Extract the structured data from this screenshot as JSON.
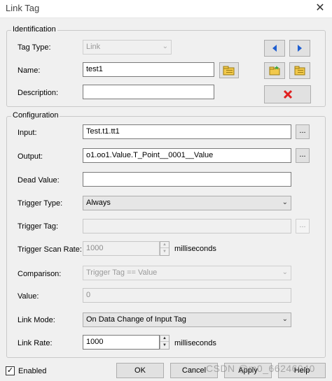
{
  "window": {
    "title": "Link Tag",
    "close_glyph": "✕"
  },
  "identification": {
    "group_label": "Identification",
    "tag_type_label": "Tag Type:",
    "tag_type_value": "Link",
    "name_label": "Name:",
    "name_value": "test1",
    "description_label": "Description:",
    "description_value": ""
  },
  "configuration": {
    "group_label": "Configuration",
    "input_label": "Input:",
    "input_value": "Test.t1.tt1",
    "output_label": "Output:",
    "output_value": "o1.oo1.Value.T_Point__0001__Value",
    "dead_value_label": "Dead Value:",
    "dead_value_value": "",
    "trigger_type_label": "Trigger Type:",
    "trigger_type_value": "Always",
    "trigger_tag_label": "Trigger Tag:",
    "trigger_tag_value": "",
    "trigger_scan_rate_label": "Trigger Scan Rate:",
    "trigger_scan_rate_value": "1000",
    "trigger_scan_rate_unit": "milliseconds",
    "comparison_label": "Comparison:",
    "comparison_value": "Trigger Tag == Value",
    "value_label": "Value:",
    "value_value": "0",
    "link_mode_label": "Link Mode:",
    "link_mode_value": "On Data Change of Input Tag",
    "link_rate_label": "Link Rate:",
    "link_rate_value": "1000",
    "link_rate_unit": "milliseconds"
  },
  "buttons": {
    "ellipsis": "...",
    "ok": "OK",
    "cancel": "Cancel",
    "apply": "Apply",
    "help": "Help"
  },
  "footer": {
    "enabled_label": "Enabled",
    "enabled_checked": "✓"
  },
  "watermark": "CSDN @m0_66246040",
  "colors": {
    "nav_arrow": "#1f5fd1",
    "delete_x": "#e02020",
    "folder": "#f2c94c"
  },
  "icons": [
    "close-icon",
    "prev-arrow-icon",
    "next-arrow-icon",
    "browse-folder-icon",
    "new-folder-icon",
    "open-folder-icon",
    "delete-icon",
    "chevron-down-icon",
    "spin-up-icon",
    "spin-down-icon",
    "checkmark-icon"
  ]
}
